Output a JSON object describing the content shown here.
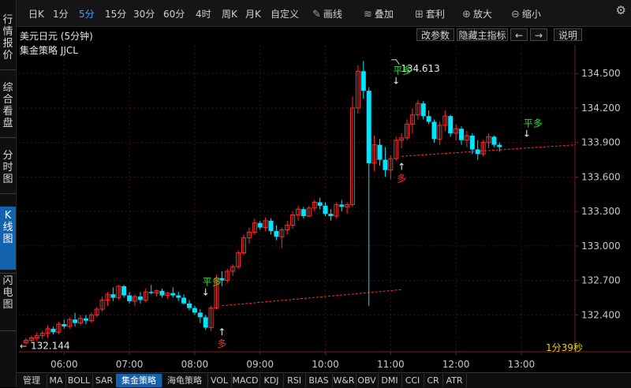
{
  "sidebar": {
    "tabs": [
      {
        "label": "行情报价",
        "active": false
      },
      {
        "label": "综合看盘",
        "active": false
      },
      {
        "label": "分时图",
        "active": false
      },
      {
        "label": "K线图",
        "active": true
      },
      {
        "label": "闪电图",
        "active": false
      }
    ]
  },
  "toolbar": {
    "periods": [
      "日K",
      "1分",
      "5分",
      "15分",
      "30分",
      "60分",
      "4时",
      "周K",
      "月K",
      "自定义"
    ],
    "active_period": "5分",
    "draw_label": "画线",
    "overlay_label": "叠加",
    "arbitrage_label": "套利",
    "zoom_in_label": "放大",
    "zoom_out_label": "缩小",
    "icons": {
      "draw": "pencil-icon",
      "overlay": "stack-icon",
      "arbitrage": "cart-icon",
      "zoom_in": "zoom-in-icon",
      "zoom_out": "zoom-out-icon",
      "settings": "gear-icon"
    }
  },
  "title_bar": {
    "title": "美元日元 (5分钟)",
    "change_params": "改参数",
    "hide_main_indicator": "隐藏主指标",
    "prev_arrow": "←",
    "next_arrow": "→",
    "help": "说明"
  },
  "strategy_label": "集金策略 JJCL",
  "countdown": "1分39秒",
  "bottom_tabs": [
    "管理",
    "MA",
    "BOLL",
    "SAR",
    "集金策略",
    "海龟策略",
    "VOL",
    "MACD",
    "KDJ",
    "RSI",
    "BIAS",
    "W&R",
    "OBV",
    "DMI",
    "CCI",
    "CR",
    "ATR"
  ],
  "bottom_active": "集金策略",
  "colors": {
    "up": "#ff2b2b",
    "down": "#00e5ff",
    "signal": "#33dd33",
    "grid": "#3a1414",
    "axis_text": "#c8c8c8"
  },
  "chart_data": {
    "type": "candlestick",
    "symbol": "美元日元",
    "period": "5分钟",
    "y_ticks": [
      132.4,
      132.7,
      133.0,
      133.3,
      133.6,
      133.9,
      134.2,
      134.5
    ],
    "y_tick_labels": [
      "132.400",
      "132.700",
      "133.000",
      "133.300",
      "133.600",
      "133.900",
      "134.200",
      "134.500"
    ],
    "ylim": [
      132.08,
      134.68
    ],
    "x_tick_labels": [
      "06:00",
      "07:00",
      "08:00",
      "09:00",
      "10:00",
      "11:00",
      "12:00",
      "13:00"
    ],
    "x_tick_index": [
      7,
      19,
      31,
      43,
      55,
      67,
      79,
      91
    ],
    "high_marker": {
      "label": "134.613",
      "value": 134.613,
      "index": 68
    },
    "low_marker": {
      "label": "132.144",
      "value": 132.144,
      "index": 0
    },
    "signals": [
      {
        "label": "平多",
        "index": 33,
        "value": 132.59,
        "kind": "exit"
      },
      {
        "label": "多",
        "index": 36,
        "value": 132.25,
        "kind": "buy"
      },
      {
        "label": "平多",
        "index": 68,
        "value": 134.43,
        "kind": "exit"
      },
      {
        "label": "多",
        "index": 69,
        "value": 133.69,
        "kind": "buy"
      },
      {
        "label": "平多",
        "index": 92,
        "value": 133.97,
        "kind": "exit"
      }
    ],
    "entry_lines": [
      {
        "from_index": 36,
        "from_value": 132.48,
        "to_index": 69,
        "to_value": 132.62
      },
      {
        "from_index": 69,
        "from_value": 133.78,
        "to_index": 101,
        "to_value": 133.88
      }
    ],
    "candles": [
      [
        132.16,
        132.2,
        132.14,
        132.18
      ],
      [
        132.18,
        132.22,
        132.15,
        132.2
      ],
      [
        132.2,
        132.25,
        132.17,
        132.22
      ],
      [
        132.22,
        132.26,
        132.19,
        132.24
      ],
      [
        132.24,
        132.31,
        132.2,
        132.28
      ],
      [
        132.28,
        132.3,
        132.23,
        132.25
      ],
      [
        132.25,
        132.34,
        132.23,
        132.32
      ],
      [
        132.32,
        132.36,
        132.28,
        132.3
      ],
      [
        132.3,
        132.38,
        132.28,
        132.36
      ],
      [
        132.36,
        132.42,
        132.3,
        132.33
      ],
      [
        132.33,
        132.4,
        132.31,
        132.37
      ],
      [
        132.37,
        132.4,
        132.32,
        132.35
      ],
      [
        132.35,
        132.42,
        132.33,
        132.4
      ],
      [
        132.4,
        132.47,
        132.38,
        132.45
      ],
      [
        132.45,
        132.56,
        132.43,
        132.53
      ],
      [
        132.53,
        132.6,
        132.48,
        132.58
      ],
      [
        132.58,
        132.64,
        132.52,
        132.55
      ],
      [
        132.55,
        132.66,
        132.53,
        132.65
      ],
      [
        132.65,
        132.66,
        132.55,
        132.57
      ],
      [
        132.57,
        132.6,
        132.5,
        132.52
      ],
      [
        132.52,
        132.58,
        132.48,
        132.56
      ],
      [
        132.56,
        132.6,
        132.5,
        132.53
      ],
      [
        132.53,
        132.63,
        132.51,
        132.6
      ],
      [
        132.6,
        132.66,
        132.58,
        132.59
      ],
      [
        132.59,
        132.62,
        132.56,
        132.61
      ],
      [
        132.61,
        132.63,
        132.55,
        132.57
      ],
      [
        132.57,
        132.6,
        132.54,
        132.59
      ],
      [
        132.59,
        132.64,
        132.55,
        132.57
      ],
      [
        132.57,
        132.6,
        132.52,
        132.55
      ],
      [
        132.55,
        132.58,
        132.49,
        132.5
      ],
      [
        132.5,
        132.53,
        132.44,
        132.46
      ],
      [
        132.46,
        132.48,
        132.4,
        132.42
      ],
      [
        132.42,
        132.45,
        132.33,
        132.38
      ],
      [
        132.38,
        132.4,
        132.27,
        132.29
      ],
      [
        132.29,
        132.48,
        132.26,
        132.46
      ],
      [
        132.46,
        132.75,
        132.45,
        132.72
      ],
      [
        132.72,
        132.78,
        132.65,
        132.7
      ],
      [
        132.7,
        132.8,
        132.68,
        132.78
      ],
      [
        132.78,
        132.84,
        132.74,
        132.82
      ],
      [
        132.82,
        132.96,
        132.8,
        132.94
      ],
      [
        132.94,
        133.1,
        132.92,
        133.07
      ],
      [
        133.07,
        133.16,
        133.02,
        133.12
      ],
      [
        133.12,
        133.24,
        133.1,
        133.2
      ],
      [
        133.2,
        133.22,
        133.14,
        133.16
      ],
      [
        133.16,
        133.25,
        133.13,
        133.22
      ],
      [
        133.22,
        133.24,
        133.1,
        133.13
      ],
      [
        133.13,
        133.18,
        133.05,
        133.08
      ],
      [
        133.08,
        133.16,
        132.98,
        133.14
      ],
      [
        133.14,
        133.22,
        133.1,
        133.18
      ],
      [
        133.18,
        133.3,
        133.15,
        133.27
      ],
      [
        133.27,
        133.35,
        133.22,
        133.32
      ],
      [
        133.32,
        133.34,
        133.24,
        133.26
      ],
      [
        133.26,
        133.35,
        133.25,
        133.33
      ],
      [
        133.33,
        133.4,
        133.3,
        133.38
      ],
      [
        133.38,
        133.42,
        133.32,
        133.35
      ],
      [
        133.35,
        133.38,
        133.26,
        133.28
      ],
      [
        133.28,
        133.32,
        133.22,
        133.26
      ],
      [
        133.26,
        133.38,
        133.24,
        133.36
      ],
      [
        133.36,
        133.4,
        133.3,
        133.34
      ],
      [
        133.34,
        133.38,
        133.28,
        133.36
      ],
      [
        133.36,
        134.3,
        133.34,
        134.2
      ],
      [
        134.2,
        134.57,
        134.15,
        134.52
      ],
      [
        134.52,
        134.61,
        134.28,
        134.35
      ],
      [
        134.35,
        134.38,
        132.48,
        133.72
      ],
      [
        133.72,
        133.96,
        133.65,
        133.88
      ],
      [
        133.88,
        133.93,
        133.7,
        133.75
      ],
      [
        133.75,
        133.86,
        133.6,
        133.66
      ],
      [
        133.66,
        133.79,
        133.58,
        133.76
      ],
      [
        133.76,
        133.95,
        133.74,
        133.92
      ],
      [
        133.92,
        133.98,
        133.85,
        133.94
      ],
      [
        133.94,
        134.1,
        133.92,
        134.06
      ],
      [
        134.06,
        134.2,
        133.98,
        134.14
      ],
      [
        134.14,
        134.27,
        134.1,
        134.24
      ],
      [
        134.24,
        134.26,
        134.1,
        134.13
      ],
      [
        134.13,
        134.18,
        134.06,
        134.08
      ],
      [
        134.08,
        134.1,
        133.9,
        133.93
      ],
      [
        133.93,
        134.08,
        133.88,
        134.05
      ],
      [
        134.05,
        134.18,
        134.0,
        134.13
      ],
      [
        134.13,
        134.14,
        133.95,
        133.98
      ],
      [
        133.98,
        134.06,
        133.92,
        134.02
      ],
      [
        134.02,
        134.04,
        133.88,
        133.92
      ],
      [
        133.92,
        134.0,
        133.86,
        133.96
      ],
      [
        133.96,
        133.98,
        133.8,
        133.84
      ],
      [
        133.84,
        133.92,
        133.75,
        133.8
      ],
      [
        133.8,
        133.92,
        133.78,
        133.9
      ],
      [
        133.9,
        133.98,
        133.85,
        133.95
      ],
      [
        133.95,
        133.96,
        133.86,
        133.88
      ],
      [
        133.88,
        133.9,
        133.82,
        133.86
      ]
    ]
  }
}
